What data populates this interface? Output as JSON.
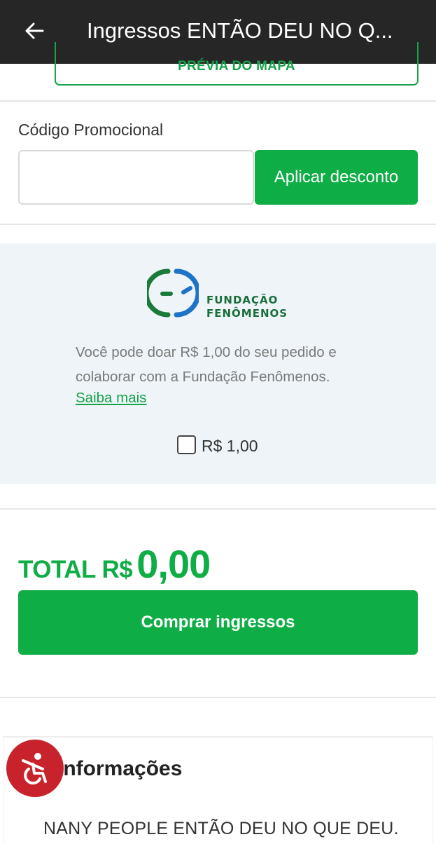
{
  "header": {
    "title": "Ingressos ENTÃO DEU NO Q...",
    "back_icon": "arrow-left-icon"
  },
  "map_button": {
    "label": "PRÉVIA DO MAPA"
  },
  "promo": {
    "label": "Código Promocional",
    "input_value": "",
    "input_placeholder": "",
    "apply_label": "Aplicar desconto"
  },
  "donation": {
    "logo_line1": "FUNDAÇÃO",
    "logo_line2": "FENÔMENOS",
    "text": "Você pode doar R$ 1,00 do seu pedido e colaborar com a Fundação Fenômenos.",
    "learn_more": "Saiba mais",
    "option_label": "R$ 1,00",
    "checked": false
  },
  "total": {
    "label": "TOTAL R$",
    "value": "0,00"
  },
  "buy_button": {
    "label": "Comprar ingressos"
  },
  "info": {
    "title": "Informações",
    "text": "NANY PEOPLE ENTÃO DEU NO QUE DEU."
  },
  "colors": {
    "brand_green": "#0fad45",
    "topbar": "#262626",
    "accessibility": "#c8232c",
    "donation_bg": "#eef4f8"
  }
}
